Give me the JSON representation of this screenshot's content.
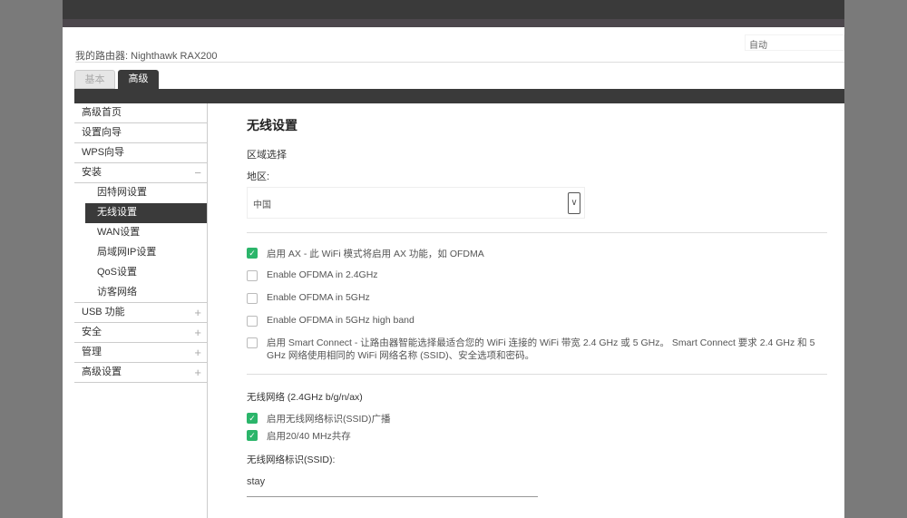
{
  "header": {
    "router_label": "我的路由器:",
    "router_name": "Nighthawk RAX200",
    "language": "自动"
  },
  "tabs": [
    {
      "label": "基本"
    },
    {
      "label": "高级"
    }
  ],
  "sidebar": {
    "items": [
      {
        "label": "高级首页"
      },
      {
        "label": "设置向导"
      },
      {
        "label": "WPS向导"
      },
      {
        "label": "安装",
        "toggle": "−"
      },
      {
        "label": "因特网设置"
      },
      {
        "label": "无线设置"
      },
      {
        "label": "WAN设置"
      },
      {
        "label": "局域网IP设置"
      },
      {
        "label": "QoS设置"
      },
      {
        "label": "访客网络"
      },
      {
        "label": "USB 功能",
        "toggle": "+"
      },
      {
        "label": "安全",
        "toggle": "+"
      },
      {
        "label": "管理",
        "toggle": "+"
      },
      {
        "label": "高级设置",
        "toggle": "+"
      }
    ]
  },
  "main": {
    "title": "无线设置",
    "region_section": "区域选择",
    "region_label": "地区:",
    "region_value": "中国",
    "options": [
      {
        "label": "启用 AX - 此 WiFi 模式将启用 AX 功能，如 OFDMA",
        "checked": true
      },
      {
        "label": "Enable OFDMA in 2.4GHz",
        "checked": false
      },
      {
        "label": "Enable OFDMA in 5GHz",
        "checked": false
      },
      {
        "label": "Enable OFDMA in 5GHz high band",
        "checked": false
      },
      {
        "label": "启用 Smart Connect - 让路由器智能选择最适合您的 WiFi 连接的 WiFi 带宽 2.4 GHz 或 5 GHz。 Smart Connect 要求 2.4 GHz 和 5 GHz 网络使用相同的 WiFi 网络名称 (SSID)、安全选项和密码。",
        "checked": false
      }
    ],
    "network_title": "无线网络 (2.4GHz b/g/n/ax)",
    "network_options": [
      {
        "label": "启用无线网络标识(SSID)广播",
        "checked": true
      },
      {
        "label": "启用20/40 MHz共存",
        "checked": true
      }
    ],
    "ssid_label": "无线网络标识(SSID):",
    "ssid_value": "stay"
  },
  "colors": {
    "accent": "#2bb56a",
    "dark": "#3a3a3a"
  }
}
